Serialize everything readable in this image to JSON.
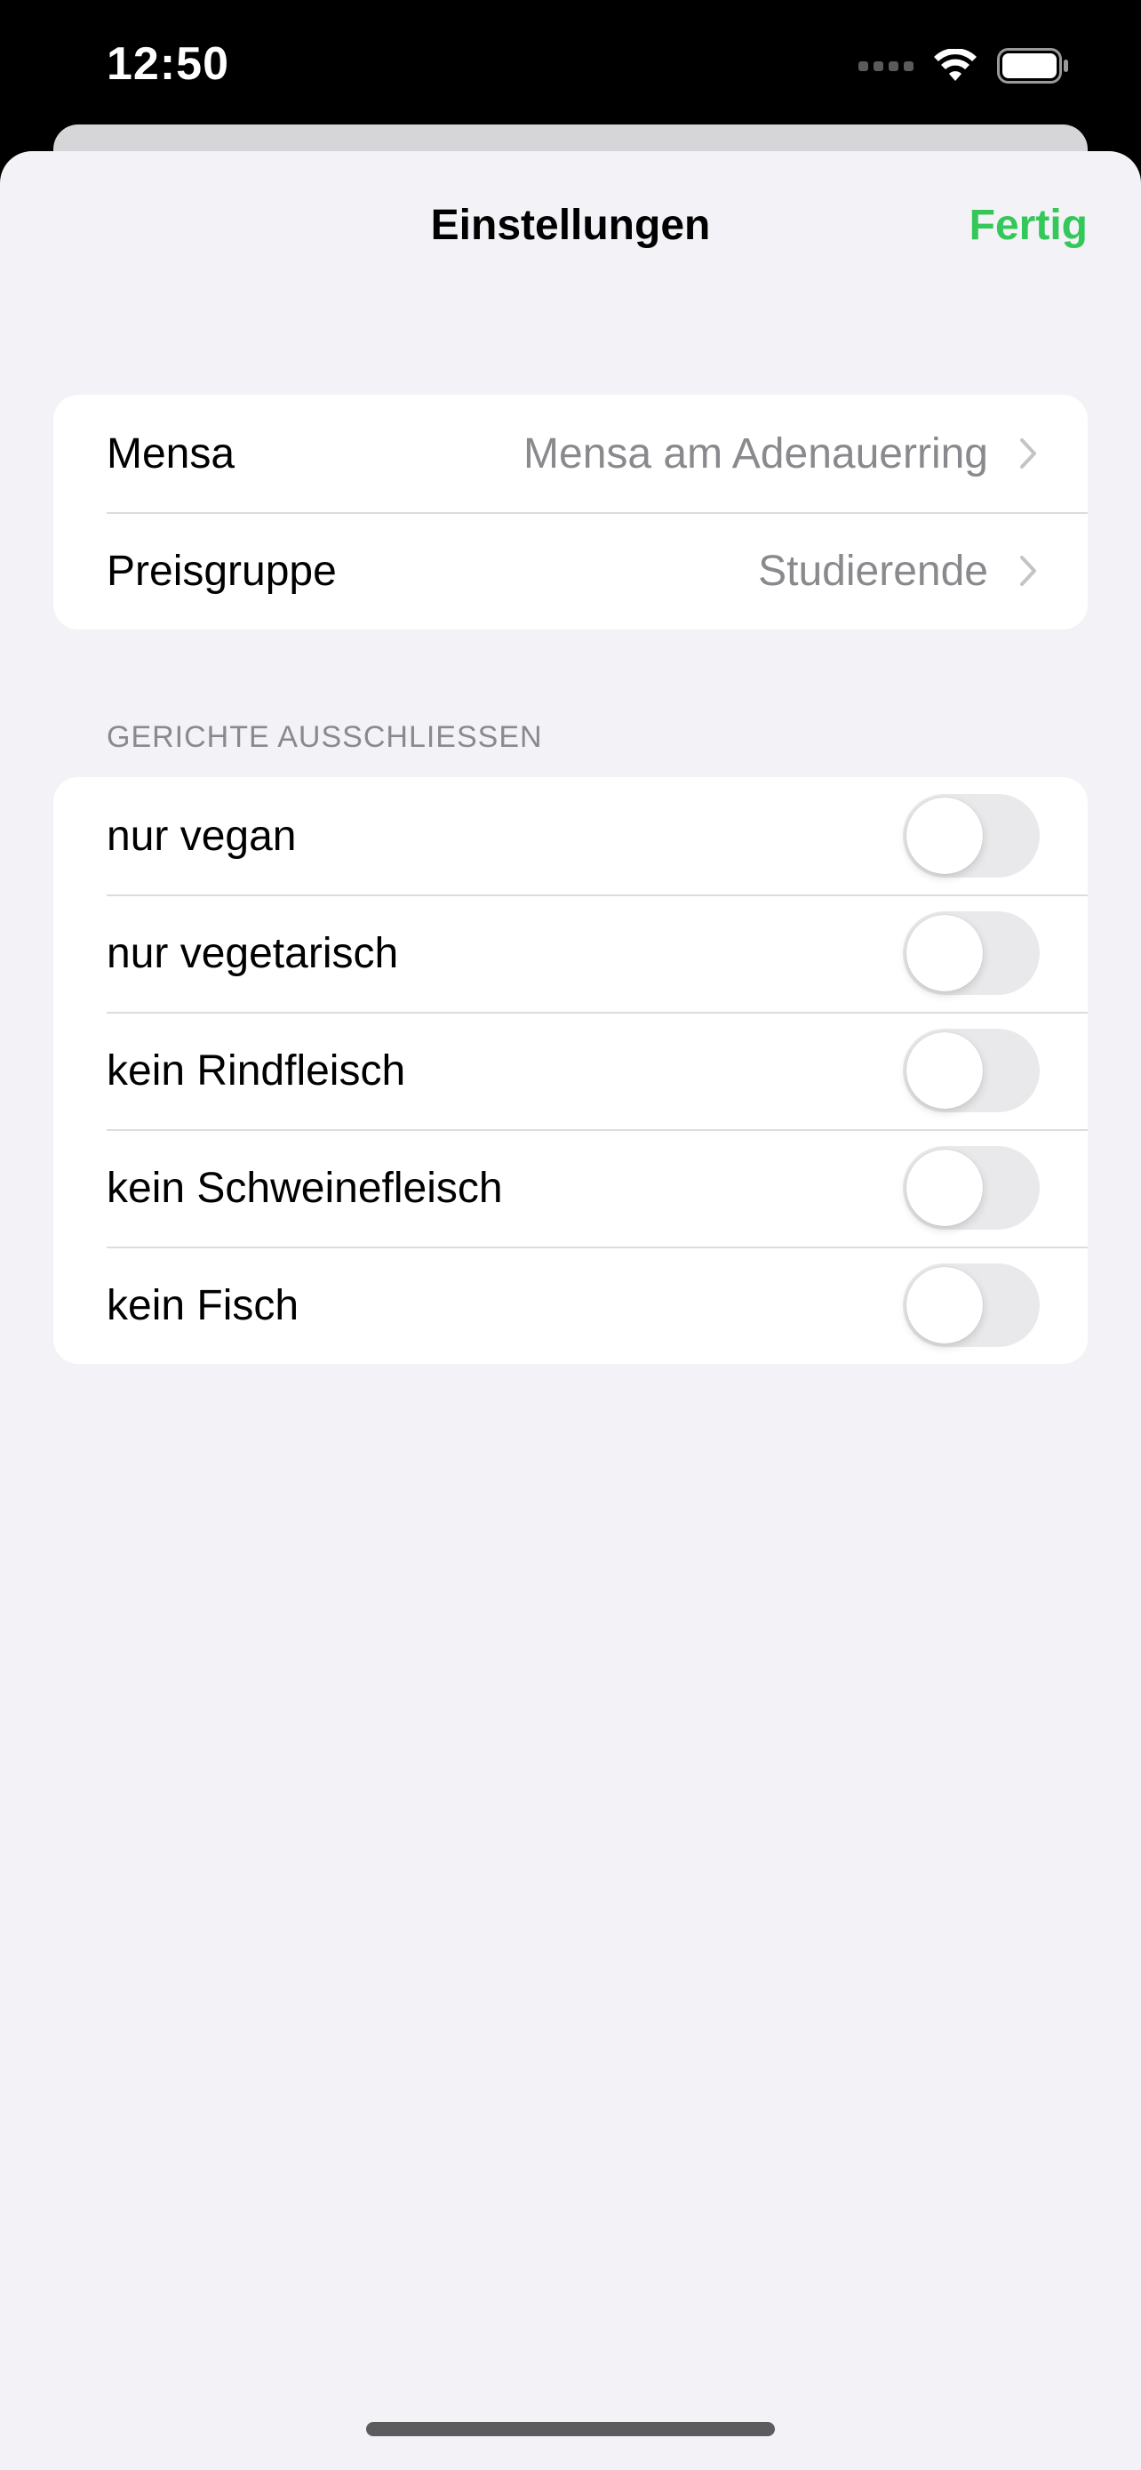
{
  "status_bar": {
    "time": "12:50"
  },
  "nav": {
    "title": "Einstellungen",
    "done_label": "Fertig"
  },
  "settings": [
    {
      "label": "Mensa",
      "value": "Mensa am Adenauerring"
    },
    {
      "label": "Preisgruppe",
      "value": "Studierende"
    }
  ],
  "exclude_section": {
    "header": "GERICHTE AUSSCHLIESSEN",
    "toggles": [
      {
        "label": "nur vegan",
        "on": false
      },
      {
        "label": "nur vegetarisch",
        "on": false
      },
      {
        "label": "kein Rindfleisch",
        "on": false
      },
      {
        "label": "kein Schweinefleisch",
        "on": false
      },
      {
        "label": "kein Fisch",
        "on": false
      }
    ]
  },
  "colors": {
    "accent": "#34c759",
    "background": "#f2f2f7",
    "secondary_text": "#8a8a8e"
  }
}
